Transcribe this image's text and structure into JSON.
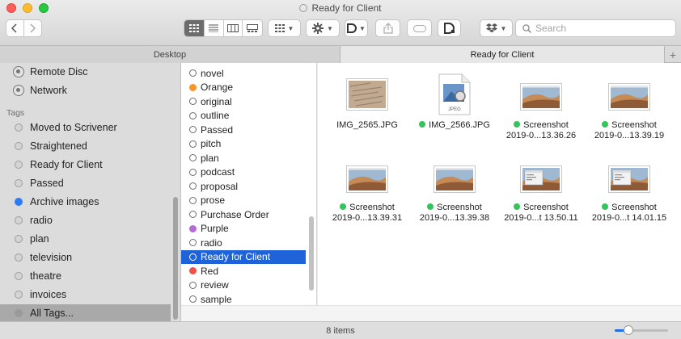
{
  "window": {
    "title": "Ready for Client"
  },
  "toolbar": {
    "search_placeholder": "Search",
    "view_modes": [
      "icon-view",
      "list-view",
      "column-view",
      "gallery-view"
    ],
    "active_view": "icon-view"
  },
  "tabs": [
    {
      "label": "Desktop",
      "active": false
    },
    {
      "label": "Ready for Client",
      "active": true
    }
  ],
  "sidebar": {
    "locations": [
      {
        "label": "Remote Disc",
        "icon": "disc-icon"
      },
      {
        "label": "Network",
        "icon": "network-icon"
      }
    ],
    "tags_heading": "Tags",
    "tags": [
      {
        "label": "Moved to Scrivener",
        "color": "#d4d4d4"
      },
      {
        "label": "Straightened",
        "color": "#d4d4d4"
      },
      {
        "label": "Ready for Client",
        "color": "#d4d4d4"
      },
      {
        "label": "Passed",
        "color": "#d4d4d4"
      },
      {
        "label": "Archive images",
        "color": "#2d7cf6"
      },
      {
        "label": "radio",
        "color": "#d4d4d4"
      },
      {
        "label": "plan",
        "color": "#d4d4d4"
      },
      {
        "label": "television",
        "color": "#d4d4d4"
      },
      {
        "label": "theatre",
        "color": "#d4d4d4"
      },
      {
        "label": "invoices",
        "color": "#d4d4d4"
      },
      {
        "label": "All Tags...",
        "color": "#9a9a9a"
      }
    ]
  },
  "tag_column": {
    "items": [
      {
        "label": "novel",
        "color": "#ffffff"
      },
      {
        "label": "Orange",
        "color": "#f7952b"
      },
      {
        "label": "original",
        "color": "#ffffff"
      },
      {
        "label": "outline",
        "color": "#ffffff"
      },
      {
        "label": "Passed",
        "color": "#ffffff"
      },
      {
        "label": "pitch",
        "color": "#ffffff"
      },
      {
        "label": "plan",
        "color": "#ffffff"
      },
      {
        "label": "podcast",
        "color": "#ffffff"
      },
      {
        "label": "proposal",
        "color": "#ffffff"
      },
      {
        "label": "prose",
        "color": "#ffffff"
      },
      {
        "label": "Purchase Order",
        "color": "#ffffff"
      },
      {
        "label": "Purple",
        "color": "#b66ad8"
      },
      {
        "label": "radio",
        "color": "#ffffff"
      },
      {
        "label": "Ready for Client",
        "color": "#ffffff",
        "selected": true
      },
      {
        "label": "Red",
        "color": "#f2504b"
      },
      {
        "label": "review",
        "color": "#ffffff"
      },
      {
        "label": "sample",
        "color": "#ffffff"
      }
    ]
  },
  "files": [
    {
      "line1": "IMG_2565.JPG",
      "line2": "",
      "tagged": false,
      "kind": "photo"
    },
    {
      "line1": "IMG_2566.JPG",
      "line2": "",
      "tagged": true,
      "kind": "jpeg-doc"
    },
    {
      "line1": "Screenshot",
      "line2": "2019-0...13.36.26",
      "tagged": true,
      "kind": "screenshot"
    },
    {
      "line1": "Screenshot",
      "line2": "2019-0...13.39.19",
      "tagged": true,
      "kind": "screenshot"
    },
    {
      "line1": "Screenshot",
      "line2": "2019-0...13.39.31",
      "tagged": true,
      "kind": "screenshot"
    },
    {
      "line1": "Screenshot",
      "line2": "2019-0...13.39.38",
      "tagged": true,
      "kind": "screenshot"
    },
    {
      "line1": "Screenshot",
      "line2": "2019-0...t 13.50.11",
      "tagged": true,
      "kind": "screenshot-window"
    },
    {
      "line1": "Screenshot",
      "line2": "2019-0...t 14.01.15",
      "tagged": true,
      "kind": "screenshot-window"
    }
  ],
  "jpeg_badge": "JPEG",
  "status": {
    "item_count": "8 items",
    "zoom_fraction": 0.25
  }
}
